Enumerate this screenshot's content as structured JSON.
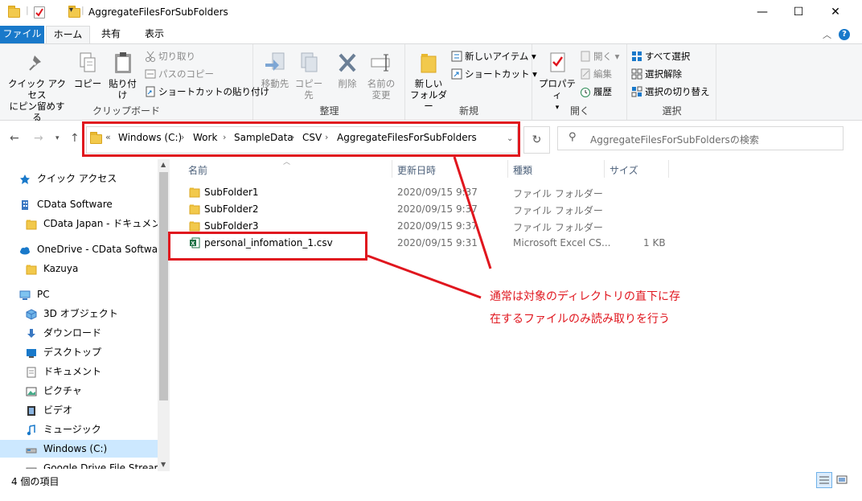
{
  "window": {
    "title": "AggregateFilesForSubFolders",
    "minimize": "—",
    "maximize": "☐",
    "close": "✕"
  },
  "ribbon_tabs": [
    "ファイル",
    "ホーム",
    "共有",
    "表示"
  ],
  "ribbon": {
    "clipboard": {
      "label": "クリップボード",
      "pin_line1": "クイック アクセス",
      "pin_line2": "にピン留めする",
      "copy": "コピー",
      "paste": "貼り付け",
      "cut": "切り取り",
      "copy_path": "パスのコピー",
      "paste_shortcut": "ショートカットの貼り付け"
    },
    "organize": {
      "label": "整理",
      "move_to": "移動先",
      "copy_to": "コピー先",
      "delete": "削除",
      "rename_line1": "名前の",
      "rename_line2": "変更"
    },
    "new": {
      "label": "新規",
      "new_folder_line1": "新しい",
      "new_folder_line2": "フォルダー",
      "new_item": "新しいアイテム",
      "shortcut": "ショートカット"
    },
    "open": {
      "label": "開く",
      "properties": "プロパティ",
      "open": "開く",
      "edit": "編集",
      "history": "履歴"
    },
    "select": {
      "label": "選択",
      "select_all": "すべて選択",
      "select_none": "選択解除",
      "invert": "選択の切り替え"
    }
  },
  "address": {
    "prefix": "«",
    "crumbs": [
      "Windows (C:)",
      "Work",
      "SampleData",
      "CSV",
      "AggregateFilesForSubFolders"
    ],
    "separator": "›",
    "search_placeholder": "AggregateFilesForSubFoldersの検索"
  },
  "nav": {
    "items": [
      {
        "label": "クイック アクセス",
        "icon": "star-icon"
      },
      {
        "label": "CData Software",
        "icon": "building-icon"
      },
      {
        "label": "CData Japan - ドキュメント",
        "icon": "folder-icon"
      },
      {
        "label": "OneDrive - CData Software",
        "icon": "cloud-icon"
      },
      {
        "label": "Kazuya",
        "icon": "folder-icon"
      },
      {
        "label": "PC",
        "icon": "pc-icon"
      },
      {
        "label": "3D オブジェクト",
        "icon": "cube-icon"
      },
      {
        "label": "ダウンロード",
        "icon": "download-icon"
      },
      {
        "label": "デスクトップ",
        "icon": "desktop-icon"
      },
      {
        "label": "ドキュメント",
        "icon": "document-icon"
      },
      {
        "label": "ピクチャ",
        "icon": "picture-icon"
      },
      {
        "label": "ビデオ",
        "icon": "video-icon"
      },
      {
        "label": "ミュージック",
        "icon": "music-icon"
      },
      {
        "label": "Windows (C:)",
        "icon": "drive-icon"
      },
      {
        "label": "Google Drive File Stream (G",
        "icon": "drive-icon"
      }
    ]
  },
  "columns": {
    "name": "名前",
    "modified": "更新日時",
    "type": "種類",
    "size": "サイズ"
  },
  "files": [
    {
      "name": "SubFolder1",
      "modified": "2020/09/15 9:37",
      "type": "ファイル フォルダー",
      "size": "",
      "icon": "folder-icon"
    },
    {
      "name": "SubFolder2",
      "modified": "2020/09/15 9:37",
      "type": "ファイル フォルダー",
      "size": "",
      "icon": "folder-icon"
    },
    {
      "name": "SubFolder3",
      "modified": "2020/09/15 9:37",
      "type": "ファイル フォルダー",
      "size": "",
      "icon": "folder-icon"
    },
    {
      "name": "personal_infomation_1.csv",
      "modified": "2020/09/15 9:31",
      "type": "Microsoft Excel CS...",
      "size": "1 KB",
      "icon": "excel-icon"
    }
  ],
  "annotation": {
    "line1": "通常は対象のディレクトリの直下に存",
    "line2": "在するファイルのみ読み取りを行う",
    "color": "#e0161e"
  },
  "status": {
    "count": "4 個の項目"
  }
}
